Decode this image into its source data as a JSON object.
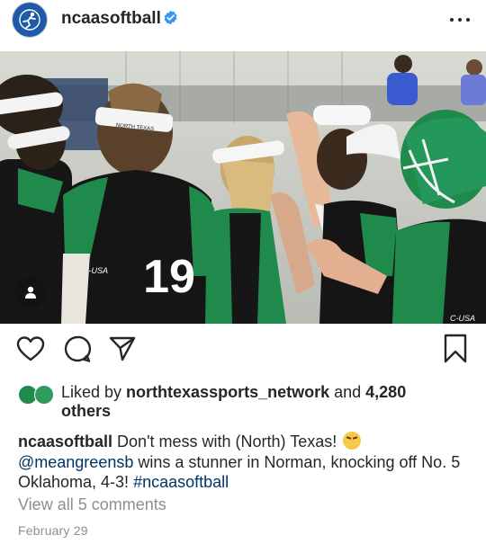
{
  "header": {
    "username": "ncaasoftball",
    "verified": true,
    "icons": {
      "avatar": "ncaa-softball-logo",
      "verified": "verified-badge-icon",
      "more": "more-options-icon"
    }
  },
  "post": {
    "image_alt_tag_icon": "user-tag-icon",
    "jersey_number": "19",
    "jersey_patch": "C-USA"
  },
  "actions": {
    "icons": [
      "heart-icon",
      "comment-icon",
      "share-icon",
      "bookmark-icon"
    ]
  },
  "likes": {
    "prefix": "Liked by ",
    "user": "northtexassports_network",
    "middle": " and ",
    "count": "4,280",
    "suffix": "others"
  },
  "caption": {
    "username": "ncaasoftball",
    "text1": "Don't mess with (North) Texas!",
    "emoji": "face-with-steam-from-nose",
    "mention": "@meangreensb",
    "text2": " wins a stunner in Norman, knocking off No. 5 Oklahoma, 4-3! ",
    "hashtag": "#ncaasoftball"
  },
  "view_comments": "View all 5 comments",
  "date": "February 29",
  "colors": {
    "text": "#262626",
    "muted": "#8e8e8e",
    "link": "#003569",
    "verified": "#3897f0",
    "team_green": "#1f8a4c",
    "avatar_blue": "#1e5aa8"
  }
}
